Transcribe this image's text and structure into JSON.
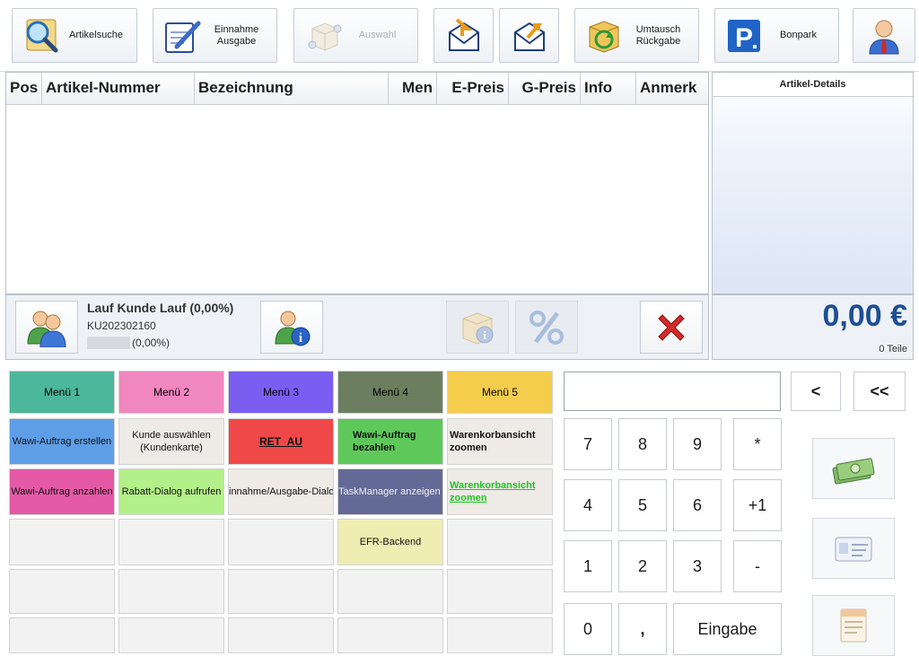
{
  "toolbar": {
    "article_search": "Artikelsuche",
    "income_expense_line1": "Einnahme",
    "income_expense_line2": "Ausgabe",
    "selection": "Auswahl",
    "exchange_line1": "Umtausch",
    "exchange_line2": "Rückgabe",
    "bonpark": "Bonpark"
  },
  "table": {
    "columns": [
      "Pos",
      "Artikel-Nummer",
      "Bezeichnung",
      "Men",
      "E-Preis",
      "G-Preis",
      "Info",
      "Anmerk"
    ]
  },
  "details": {
    "title": "Artikel-Details"
  },
  "customer": {
    "name": "Lauf Kunde Lauf (0,00%)",
    "number": "KU202302160",
    "discount": "(0,00%)"
  },
  "total": {
    "amount": "0,00 €",
    "items": "0 Teile"
  },
  "menu_tabs": [
    {
      "label": "Menü 1",
      "color": "#4cb79a"
    },
    {
      "label": "Menü 2",
      "color": "#f087bf"
    },
    {
      "label": "Menü 3",
      "color": "#7a5ef2"
    },
    {
      "label": "Menü 4",
      "color": "#6b7e5f"
    },
    {
      "label": "Menü 5",
      "color": "#f5cd4c"
    }
  ],
  "menu_buttons": {
    "r1c1": "Wawi-Auftrag erstellen",
    "r1c2_line1": "Kunde auswählen",
    "r1c2_line2": "(Kundenkarte)",
    "r1c3": "RET_AU",
    "r1c4_line1": "Wawi-Auftrag",
    "r1c4_line2": "bezahlen",
    "r1c5_line1": "Warenkorbansicht",
    "r1c5_line2": "zoomen",
    "r2c1": "Wawi-Auftrag anzahlen",
    "r2c2": "Rabatt-Dialog aufrufen",
    "r2c3": "innahme/Ausgabe-Dialo",
    "r2c4": "TaskManager anzeigen",
    "r2c5_line1": "Warenkorbansicht",
    "r2c5_line2": "zoomen",
    "r3c4": "EFR-Backend"
  },
  "numpad": {
    "back": "<",
    "back_all": "<<",
    "k7": "7",
    "k8": "8",
    "k9": "9",
    "star": "*",
    "k4": "4",
    "k5": "5",
    "k6": "6",
    "plus1": "+1",
    "k1": "1",
    "k2": "2",
    "k3": "3",
    "minus": "-",
    "k0": "0",
    "comma": ",",
    "enter": "Eingabe",
    "input_value": ""
  }
}
